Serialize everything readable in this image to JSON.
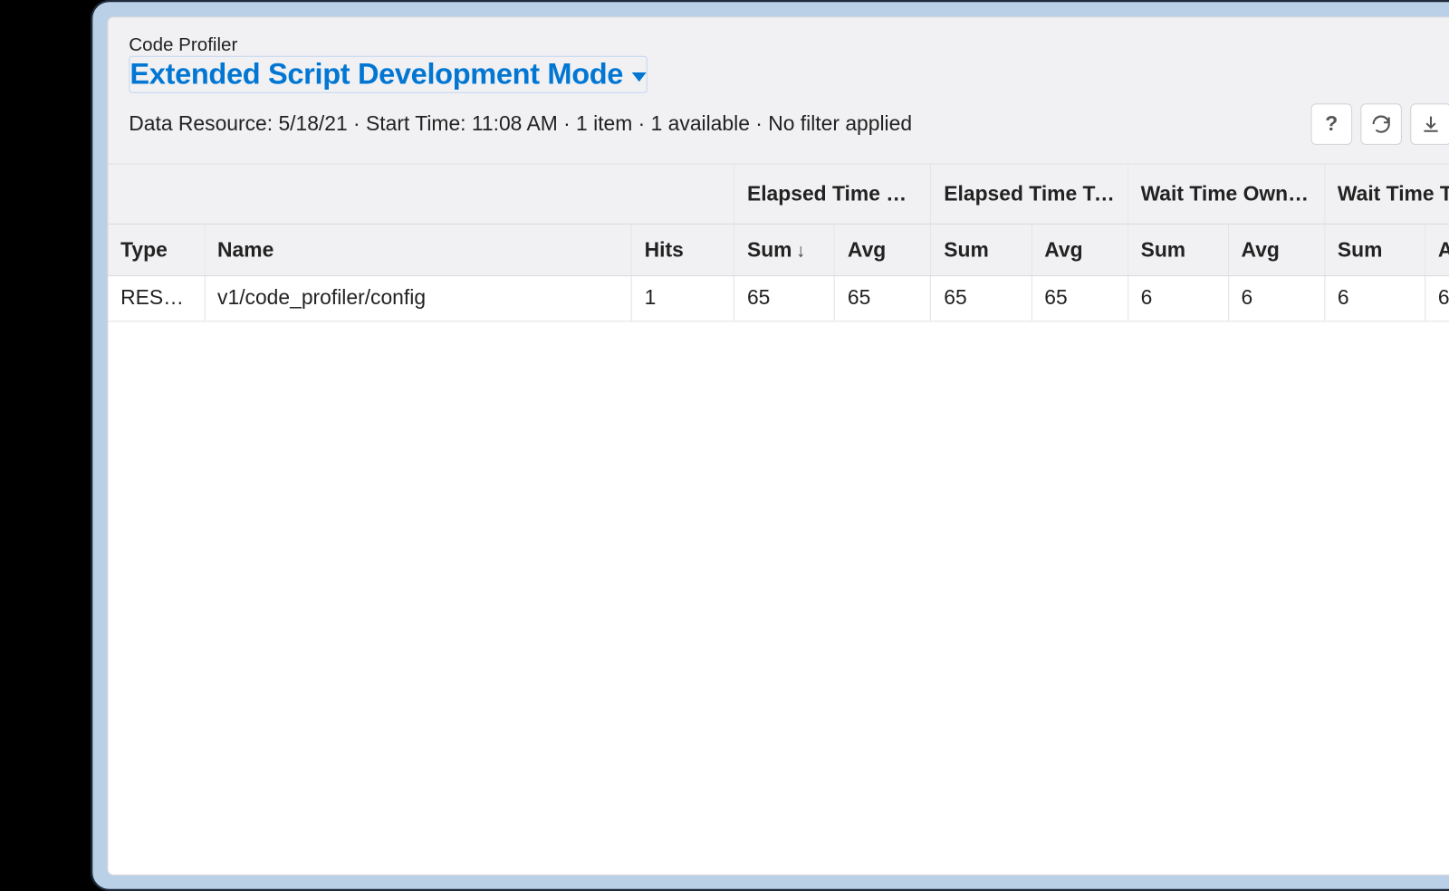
{
  "header": {
    "breadcrumb": "Code Profiler",
    "mode": "Extended Script Development Mode",
    "status": "Data Resource: 5/18/21 · Start Time: 11:08 AM · 1 item · 1 available · No filter applied"
  },
  "toolbar": {
    "help_name": "help-icon",
    "refresh_name": "refresh-icon",
    "download_name": "download-icon",
    "filter_name": "filter-icon"
  },
  "table": {
    "group_headers": {
      "blank": "",
      "elapsed_own": "Elapsed Time O…",
      "elapsed_total": "Elapsed Time To…",
      "wait_own": "Wait Time Own …",
      "wait_total": "Wait Time Total …"
    },
    "sub_headers": {
      "type": "Type",
      "name": "Name",
      "hits": "Hits",
      "sum": "Sum",
      "avg": "Avg",
      "sort_indicator": "↓"
    },
    "rows": [
      {
        "type": "REST_…",
        "name": "v1/code_profiler/config",
        "hits": "1",
        "eo_sum": "65",
        "eo_avg": "65",
        "et_sum": "65",
        "et_avg": "65",
        "wo_sum": "6",
        "wo_avg": "6",
        "wt_sum": "6",
        "wt_avg": "6"
      }
    ]
  }
}
